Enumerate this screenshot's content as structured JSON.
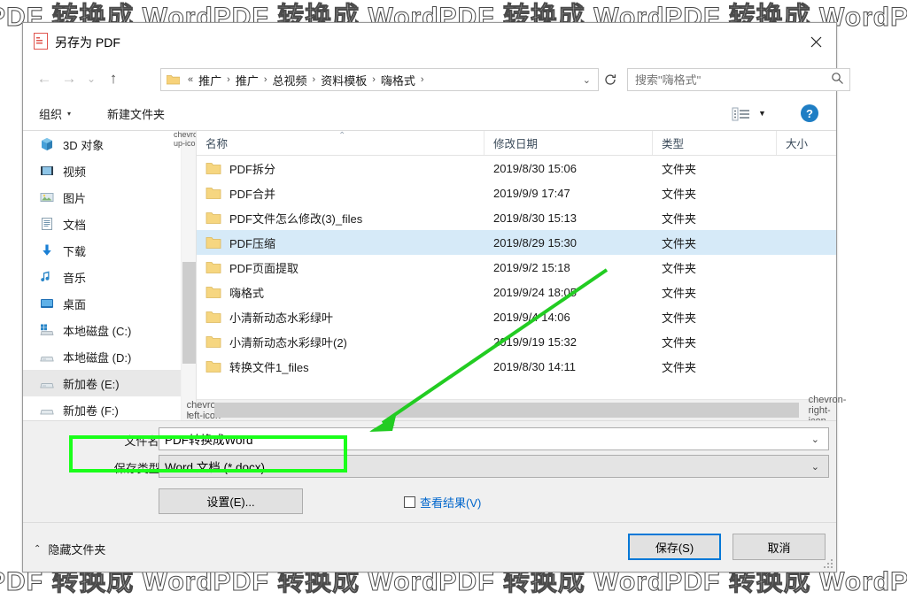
{
  "watermark": {
    "text": "PDF 转换成 WordPDF 转换成 WordPDF 转换成 WordPDF 转换成 WordPDF 转换成",
    "color": "#4a4a4a"
  },
  "dialog": {
    "title": "另存为 PDF",
    "title_icon": "pdf-icon",
    "close_icon": "close-icon"
  },
  "nav": {
    "back_icon": "arrow-left-icon",
    "forward_icon": "arrow-right-icon",
    "recent_icon": "chevron-down-icon",
    "up_icon": "arrow-up-icon",
    "refresh_icon": "refresh-icon",
    "breadcrumb_prefix": "«",
    "breadcrumb": [
      "推广",
      "推广",
      "总视频",
      "资料模板",
      "嗨格式"
    ],
    "breadcrumb_separator": "›",
    "address_chevron": "⌄"
  },
  "search": {
    "placeholder": "搜索\"嗨格式\"",
    "value": "",
    "icon": "search-icon"
  },
  "toolbar": {
    "organize_label": "组织",
    "organize_caret": "▾",
    "new_folder_label": "新建文件夹",
    "view_icon": "list-view-icon",
    "view_caret": "▼",
    "help_icon": "help-icon",
    "help_glyph": "?"
  },
  "sidebar": {
    "items": [
      {
        "label": "3D 对象",
        "icon": "3d-object-icon",
        "selected": false
      },
      {
        "label": "视频",
        "icon": "video-icon",
        "selected": false
      },
      {
        "label": "图片",
        "icon": "picture-icon",
        "selected": false
      },
      {
        "label": "文档",
        "icon": "document-icon",
        "selected": false
      },
      {
        "label": "下载",
        "icon": "download-icon",
        "selected": false
      },
      {
        "label": "音乐",
        "icon": "music-icon",
        "selected": false
      },
      {
        "label": "桌面",
        "icon": "desktop-icon",
        "selected": false
      },
      {
        "label": "本地磁盘 (C:)",
        "icon": "windows-drive-icon",
        "selected": false
      },
      {
        "label": "本地磁盘 (D:)",
        "icon": "drive-icon",
        "selected": false
      },
      {
        "label": "新加卷 (E:)",
        "icon": "drive-icon",
        "selected": true
      },
      {
        "label": "新加卷 (F:)",
        "icon": "drive-icon",
        "selected": false
      }
    ],
    "scroll_up_icon": "chevron-up-icon",
    "scroll_down_icon": "chevron-down-icon"
  },
  "filelist": {
    "columns": [
      "名称",
      "修改日期",
      "类型",
      "大小"
    ],
    "sort_caret": "⌃",
    "rows": [
      {
        "name": "PDF拆分",
        "date": "2019/8/30 15:06",
        "type": "文件夹",
        "size": "",
        "selected": false
      },
      {
        "name": "PDF合并",
        "date": "2019/9/9 17:47",
        "type": "文件夹",
        "size": "",
        "selected": false
      },
      {
        "name": "PDF文件怎么修改(3)_files",
        "date": "2019/8/30 15:13",
        "type": "文件夹",
        "size": "",
        "selected": false
      },
      {
        "name": "PDF压缩",
        "date": "2019/8/29 15:30",
        "type": "文件夹",
        "size": "",
        "selected": true
      },
      {
        "name": "PDF页面提取",
        "date": "2019/9/2 15:18",
        "type": "文件夹",
        "size": "",
        "selected": false
      },
      {
        "name": "嗨格式",
        "date": "2019/9/24 18:05",
        "type": "文件夹",
        "size": "",
        "selected": false
      },
      {
        "name": "小清新动态水彩绿叶",
        "date": "2019/9/4 14:06",
        "type": "文件夹",
        "size": "",
        "selected": false
      },
      {
        "name": "小清新动态水彩绿叶(2)",
        "date": "2019/9/19 15:32",
        "type": "文件夹",
        "size": "",
        "selected": false
      },
      {
        "name": "转换文件1_files",
        "date": "2019/8/30 14:11",
        "type": "文件夹",
        "size": "",
        "selected": false
      }
    ],
    "hscroll_left_icon": "chevron-left-icon",
    "hscroll_right_icon": "chevron-right-icon"
  },
  "form": {
    "filename_label": "文件名(N):",
    "filename_value": "PDF转换成Word",
    "filetype_label": "保存类型(T):",
    "filetype_value": "Word 文档 (*.docx)",
    "combo_chevron": "⌄",
    "settings_button": "设置(E)...",
    "view_result_label": "查看结果(V)",
    "view_result_checked": false
  },
  "footer": {
    "hide_folders_label": "隐藏文件夹",
    "hide_folders_caret": "⌃",
    "save_button": "保存(S)",
    "cancel_button": "取消"
  },
  "annotations": {
    "highlight_color": "#1aff1a",
    "arrow_color": "#22cc22",
    "arrow_from": "685,305",
    "arrow_to": "420,485"
  }
}
